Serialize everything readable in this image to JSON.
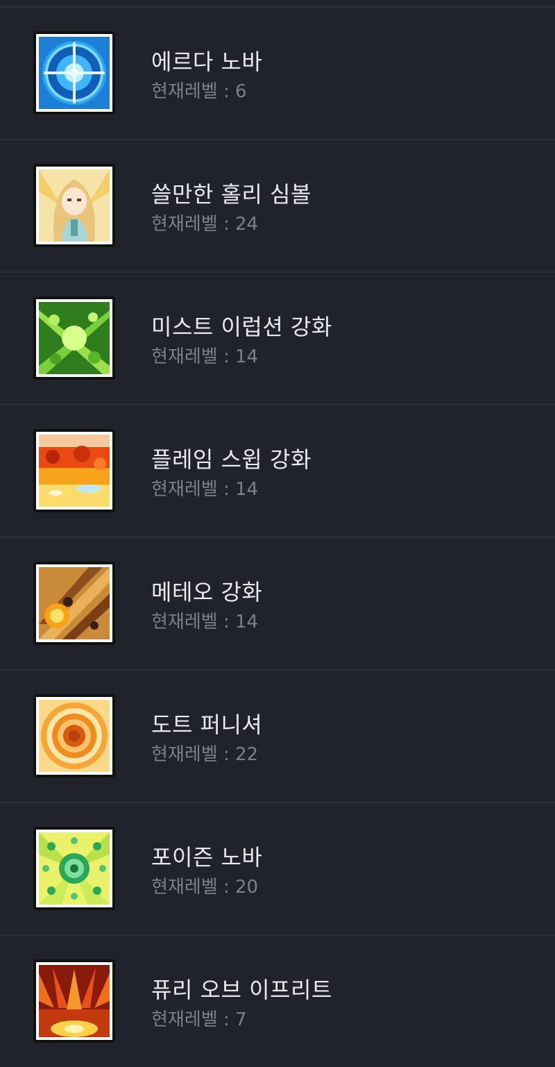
{
  "level_prefix": "현재레벨 : ",
  "skills": [
    {
      "name": "에르다 노바",
      "level": "현재레벨 : 6",
      "icon": "erda-nova-icon"
    },
    {
      "name": "쓸만한 홀리 심볼",
      "level": "현재레벨 : 24",
      "icon": "holy-symbol-icon"
    },
    {
      "name": "미스트 이럽션 강화",
      "level": "현재레벨 : 14",
      "icon": "mist-eruption-icon"
    },
    {
      "name": "플레임 스윕 강화",
      "level": "현재레벨 : 14",
      "icon": "flame-sweep-icon"
    },
    {
      "name": "메테오 강화",
      "level": "현재레벨 : 14",
      "icon": "meteor-icon"
    },
    {
      "name": "도트 퍼니셔",
      "level": "현재레벨 : 22",
      "icon": "dot-punisher-icon"
    },
    {
      "name": "포이즌 노바",
      "level": "현재레벨 : 20",
      "icon": "poison-nova-icon"
    },
    {
      "name": "퓨리 오브 이프리트",
      "level": "현재레벨 : 7",
      "icon": "fury-of-ifrit-icon"
    }
  ],
  "colors": {
    "background": "#20232b",
    "divider": "#2c3039",
    "name_text": "#e9eaee",
    "level_text": "#7c808a"
  }
}
